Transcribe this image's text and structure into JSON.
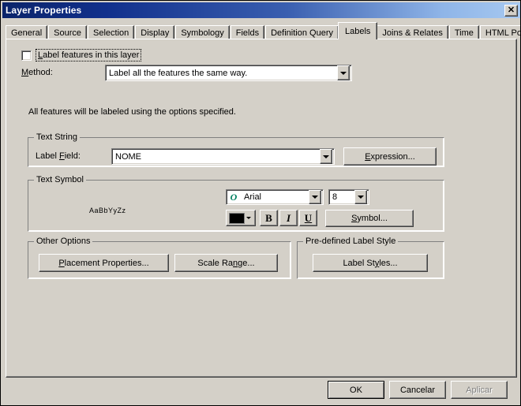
{
  "window": {
    "title": "Layer Properties",
    "close_label": "✕"
  },
  "tabs": [
    {
      "label": "General",
      "selected": false
    },
    {
      "label": "Source",
      "selected": false
    },
    {
      "label": "Selection",
      "selected": false
    },
    {
      "label": "Display",
      "selected": false
    },
    {
      "label": "Symbology",
      "selected": false
    },
    {
      "label": "Fields",
      "selected": false
    },
    {
      "label": "Definition Query",
      "selected": false
    },
    {
      "label": "Labels",
      "selected": true
    },
    {
      "label": "Joins & Relates",
      "selected": false
    },
    {
      "label": "Time",
      "selected": false
    },
    {
      "label": "HTML Popup",
      "selected": false
    }
  ],
  "labels_tab": {
    "enable_checkbox": {
      "label": "Label features in this layer",
      "checked": false
    },
    "method": {
      "label": "Method:",
      "value": "Label all the features the same way."
    },
    "description": "All features will be labeled using the options specified.",
    "text_string": {
      "group_title": "Text String",
      "field_label": "Label Field:",
      "field_value": "NOME",
      "expression_button": "Expression..."
    },
    "text_symbol": {
      "group_title": "Text Symbol",
      "preview": "AaBbYyZz",
      "font_name": "Arial",
      "font_icon": "O",
      "font_size": "8",
      "color": "#000000",
      "bold_label": "B",
      "italic_label": "I",
      "underline_label": "U",
      "symbol_button": "Symbol..."
    },
    "other_options": {
      "group_title": "Other Options",
      "placement_button": "Placement Properties...",
      "scale_button": "Scale Range..."
    },
    "predefined_style": {
      "group_title": "Pre-defined Label Style",
      "label_styles_button": "Label Styles..."
    }
  },
  "footer": {
    "ok": "OK",
    "cancel": "Cancelar",
    "apply": "Aplicar"
  }
}
